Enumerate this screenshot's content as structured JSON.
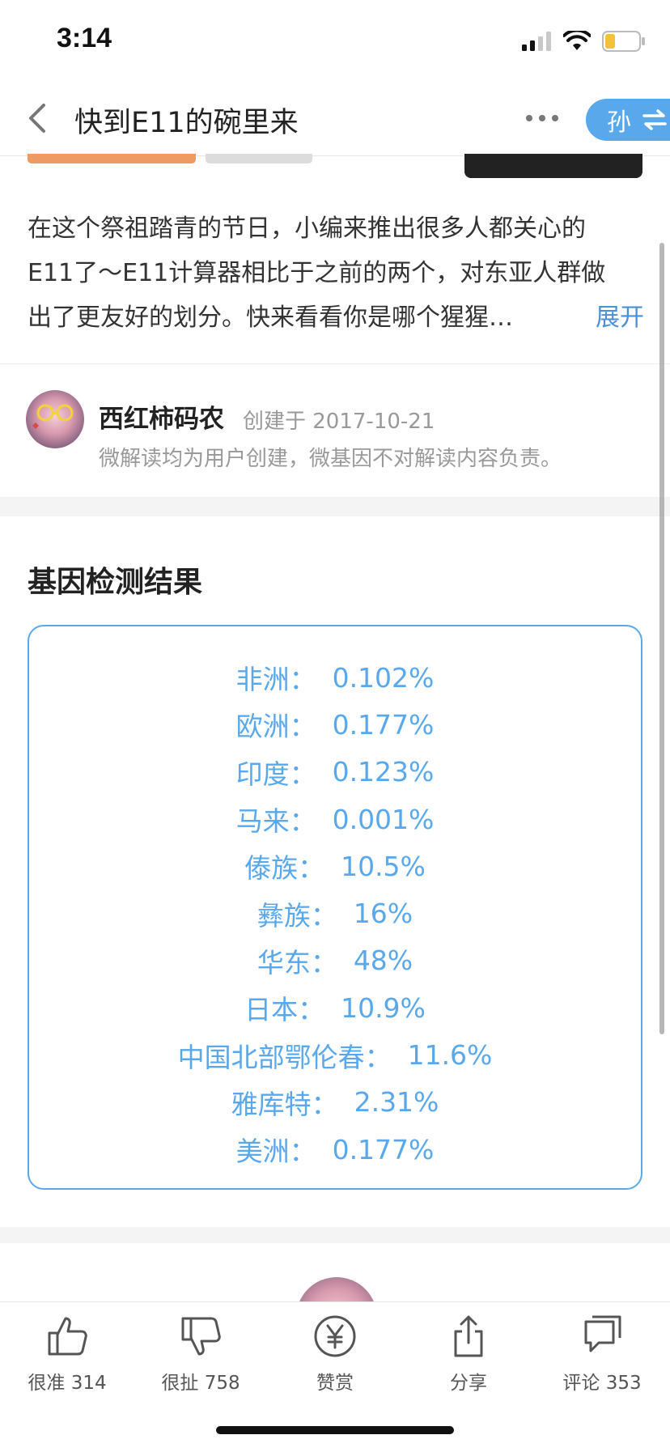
{
  "status_bar": {
    "time": "3:14"
  },
  "header": {
    "title": "快到E11的碗里来",
    "switch_label": "孙"
  },
  "intro": {
    "lines": [
      "在这个祭祖踏青的节日，小编来推出很多人都关心的",
      "E11了～E11计算器相比于之前的两个，对东亚人群做",
      "出了更友好的划分。快来看看你是哪个猩猩…"
    ],
    "expand_label": "展开"
  },
  "author": {
    "name": "西红柿码农",
    "created": "创建于 2017-10-21",
    "disclaimer": "微解读均为用户创建，微基因不对解读内容负责。"
  },
  "results": {
    "title": "基因检测结果",
    "rows": [
      {
        "label": "非洲：",
        "value": "0.102%"
      },
      {
        "label": "欧洲：",
        "value": "0.177%"
      },
      {
        "label": "印度：",
        "value": "0.123%"
      },
      {
        "label": "马来：",
        "value": "0.001%"
      },
      {
        "label": "傣族：",
        "value": "10.5%"
      },
      {
        "label": "彝族：",
        "value": "16%"
      },
      {
        "label": "华东：",
        "value": "48%"
      },
      {
        "label": "日本：",
        "value": "10.9%"
      },
      {
        "label": "中国北部鄂伦春：",
        "value": "11.6%"
      },
      {
        "label": "雅库特：",
        "value": "2.31%"
      },
      {
        "label": "美洲：",
        "value": "0.177%"
      }
    ]
  },
  "toolbar": {
    "like": "很准 314",
    "dislike": "很扯 758",
    "reward": "赞赏",
    "share": "分享",
    "comment": "评论 353"
  },
  "colors": {
    "accent": "#5aa8ec",
    "link": "#4a90d9",
    "orange_tab": "#ef9a62"
  },
  "icons": [
    "back-chevron-icon",
    "more-dots-icon",
    "switch-arrows-icon",
    "thumbs-up-icon",
    "thumbs-down-icon",
    "yen-coin-icon",
    "share-icon",
    "comment-icon"
  ]
}
